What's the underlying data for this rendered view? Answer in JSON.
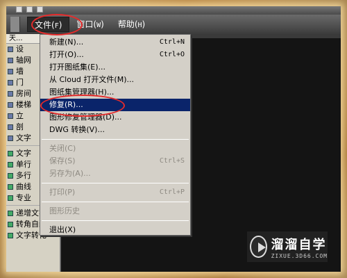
{
  "menubar": {
    "items": [
      {
        "label": "文件(",
        "hk": "F",
        "close": ")"
      },
      {
        "label": "窗口(",
        "hk": "W",
        "close": ")"
      },
      {
        "label": "帮助(",
        "hk": "H",
        "close": ")"
      }
    ]
  },
  "left_panel": {
    "header": "天...",
    "items": [
      "设",
      "轴网",
      "墙",
      "门",
      "房间",
      "楼梯",
      "立",
      "剖",
      "文字"
    ],
    "sub_items": [
      "文字",
      "单行",
      "多行",
      "曲线",
      "专业"
    ],
    "bottom_items": [
      "递增文字",
      "转角自纠",
      "文字转化"
    ]
  },
  "file_menu": {
    "items": [
      {
        "label": "新建(N)...",
        "shortcut": "Ctrl+N",
        "state": "normal"
      },
      {
        "label": "打开(O)...",
        "shortcut": "Ctrl+O",
        "state": "normal"
      },
      {
        "label": "打开图纸集(E)...",
        "shortcut": "",
        "state": "normal"
      },
      {
        "label": "从 Cloud 打开文件(M)...",
        "shortcut": "",
        "state": "normal"
      },
      {
        "label": "图纸集管理器(H)...",
        "shortcut": "",
        "state": "normal"
      },
      {
        "label": "修复(R)...",
        "shortcut": "",
        "state": "selected"
      },
      {
        "label": "图形修复管理器(D)...",
        "shortcut": "",
        "state": "normal"
      },
      {
        "label": "DWG 转换(V)...",
        "shortcut": "",
        "state": "normal"
      },
      {
        "label": "关闭(C)",
        "shortcut": "",
        "state": "disabled"
      },
      {
        "label": "保存(S)",
        "shortcut": "Ctrl+S",
        "state": "disabled"
      },
      {
        "label": "另存为(A)...",
        "shortcut": "",
        "state": "disabled"
      },
      {
        "label": "打印(P)",
        "shortcut": "Ctrl+P",
        "state": "disabled"
      },
      {
        "label": "图形历史",
        "shortcut": "",
        "state": "disabled"
      },
      {
        "label": "退出(X)",
        "shortcut": "",
        "state": "normal"
      }
    ]
  },
  "watermark": {
    "title": "溜溜自学",
    "subtitle": "ZIXUE.3D66.COM"
  }
}
